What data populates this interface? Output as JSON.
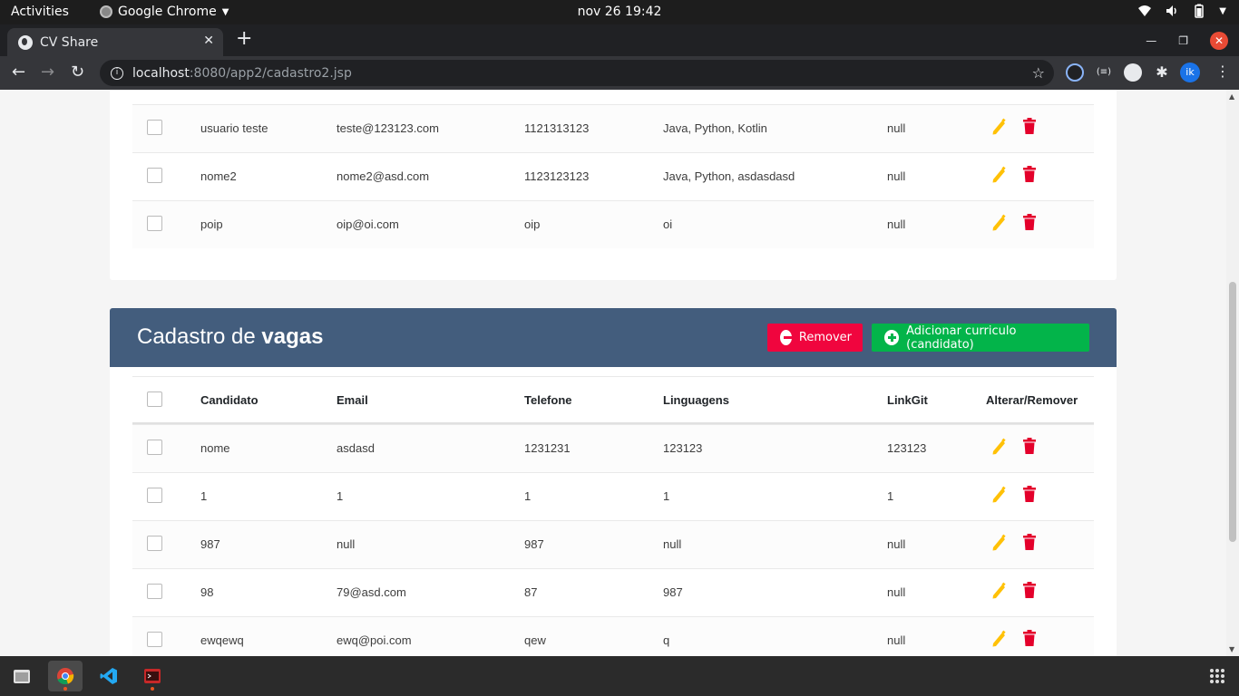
{
  "topbar": {
    "activities": "Activities",
    "app_name": "Google Chrome",
    "clock": "nov 26  19:42"
  },
  "browser": {
    "tab_title": "CV Share",
    "url_host": "localhost",
    "url_path": ":8080/app2/cadastro2.jsp",
    "profile_initials": "ik"
  },
  "top_table": {
    "rows": [
      {
        "name": "usuario teste",
        "email": "teste@123123.com",
        "telefone": "1121313123",
        "linguagens": "Java, Python, Kotlin",
        "linkgit": "null"
      },
      {
        "name": "nome2",
        "email": "nome2@asd.com",
        "telefone": "1123123123",
        "linguagens": "Java, Python, asdasdasd",
        "linkgit": "null"
      },
      {
        "name": "poip",
        "email": "oip@oi.com",
        "telefone": "oip",
        "linguagens": "oi",
        "linkgit": "null"
      }
    ]
  },
  "vagas": {
    "title_prefix": "Cadastro de ",
    "title_bold": "vagas",
    "remove_label": "Remover",
    "add_label": "Adicionar curriculo (candidato)",
    "columns": {
      "candidato": "Candidato",
      "email": "Email",
      "telefone": "Telefone",
      "linguagens": "Linguagens",
      "linkgit": "LinkGit",
      "acoes": "Alterar/Remover"
    },
    "rows": [
      {
        "name": "nome",
        "email": "asdasd",
        "telefone": "1231231",
        "linguagens": "123123",
        "linkgit": "123123"
      },
      {
        "name": "1",
        "email": "1",
        "telefone": "1",
        "linguagens": "1",
        "linkgit": "1"
      },
      {
        "name": "987",
        "email": "null",
        "telefone": "987",
        "linguagens": "null",
        "linkgit": "null"
      },
      {
        "name": "98",
        "email": "79@asd.com",
        "telefone": "87",
        "linguagens": "987",
        "linkgit": "null"
      },
      {
        "name": "ewqewq",
        "email": "ewq@poi.com",
        "telefone": "qew",
        "linguagens": "q",
        "linkgit": "null"
      }
    ]
  },
  "colors": {
    "header_bg": "#435d7d",
    "remove_btn": "#f0053e",
    "add_btn": "#03b44a",
    "edit_icon": "#ffc107",
    "delete_icon": "#e4002b"
  }
}
